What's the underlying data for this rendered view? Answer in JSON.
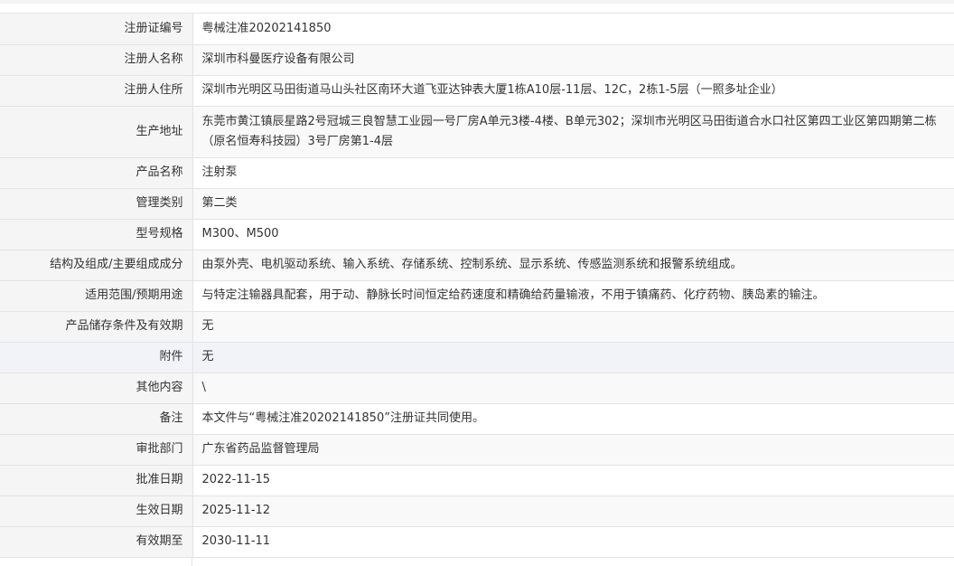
{
  "rows": [
    {
      "label": "注册证编号",
      "value": "粤械注准20202141850"
    },
    {
      "label": "注册人名称",
      "value": "深圳市科曼医疗设备有限公司"
    },
    {
      "label": "注册人住所",
      "value": "深圳市光明区马田街道马山头社区南环大道飞亚达钟表大厦1栋A10层-11层、12C，2栋1-5层（一照多址企业）"
    },
    {
      "label": "生产地址",
      "value": "东莞市黄江镇辰星路2号冠城三良智慧工业园一号厂房A单元3楼-4楼、B单元302；深圳市光明区马田街道合水口社区第四工业区第四期第二栋（原名恒寿科技园）3号厂房第1-4层"
    },
    {
      "label": "产品名称",
      "value": "注射泵"
    },
    {
      "label": "管理类别",
      "value": "第二类"
    },
    {
      "label": "型号规格",
      "value": "M300、M500"
    },
    {
      "label": "结构及组成/主要组成成分",
      "value": "由泵外壳、电机驱动系统、输入系统、存储系统、控制系统、显示系统、传感监测系统和报警系统组成。"
    },
    {
      "label": "适用范围/预期用途",
      "value": "与特定注输器具配套，用于动、静脉长时间恒定给药速度和精确给药量输液，不用于镇痛药、化疗药物、胰岛素的输注。"
    },
    {
      "label": "产品储存条件及有效期",
      "value": "无"
    },
    {
      "label": "附件",
      "value": "无"
    },
    {
      "label": "其他内容",
      "value": "\\"
    },
    {
      "label": "备注",
      "value": "本文件与“粤械注准20202141850”注册证共同使用。"
    },
    {
      "label": "审批部门",
      "value": "广东省药品监督管理局"
    },
    {
      "label": "批准日期",
      "value": "2022-11-15"
    },
    {
      "label": "生效日期",
      "value": "2025-11-12"
    },
    {
      "label": "有效期至",
      "value": "2030-11-11"
    }
  ]
}
